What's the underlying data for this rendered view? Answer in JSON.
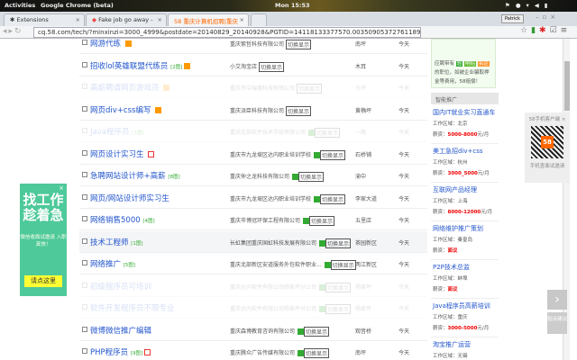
{
  "system_bar": {
    "activities": "Activities",
    "app": "Google Chrome (beta)",
    "clock": "Mon 15:53"
  },
  "tabs": [
    {
      "label": "Extensions"
    },
    {
      "label": "Fake job go away - "
    },
    {
      "label": "58 重庆计算机招聘|重庆"
    }
  ],
  "profile": "Patrick",
  "address_bar": {
    "url": "cq.58.com/tech/?minxinzi=3000_4999&postdate=20140829_20140928&PGTID=14118133377570.0035090537276118994&ClickID=1"
  },
  "switch_label": "切换显示",
  "jobs": [
    {
      "title": "网游代练",
      "pics": "",
      "company": "重庆紫哲科技有限公司",
      "area": "南坪",
      "date": "今天",
      "badge": "orange",
      "verified": false,
      "faded": false
    },
    {
      "title": "招收lol英雄联盟代练员",
      "pics": "[2图]",
      "company": "小艾淘宝店",
      "area": "木耳",
      "date": "今天",
      "badge": "orange",
      "verified": false,
      "faded": false
    },
    {
      "title": "高薪聘请网页游戏员",
      "pics": "",
      "company": "重庆市中瑞德科技有限公司",
      "area": "大坪",
      "date": "今天",
      "badge": "orange",
      "verified": false,
      "faded": true
    },
    {
      "title": "网页div+css编写",
      "pics": "",
      "company": "重庆派臣科技有限公司",
      "area": "黄桷坪",
      "date": "今天",
      "badge": "orange",
      "verified": false,
      "faded": false
    },
    {
      "title": "Java程序员",
      "pics": "[1图]",
      "company": "重庆北部软件技术学校有限公司",
      "area": "一路",
      "date": "今天",
      "badge": "",
      "verified": true,
      "faded": true
    },
    {
      "title": "网页设计实习生",
      "pics": "",
      "company": "重庆市九龙坡区达内职业培训学校",
      "area": "石桥铺",
      "date": "今天",
      "badge": "red",
      "verified": true,
      "faded": false
    },
    {
      "title": "急聘网站设计师+高薪",
      "pics": "[8图]",
      "company": "重庆仲之龙科技有限公司",
      "area": "渝中",
      "date": "今天",
      "badge": "",
      "verified": true,
      "faded": false
    },
    {
      "title": "网页/网站设计师实习生",
      "pics": "",
      "company": "重庆市九龙坡区达内职业培训学校",
      "area": "李家大道",
      "date": "今天",
      "badge": "",
      "verified": true,
      "faded": false
    },
    {
      "title": "网络销售5000",
      "pics": "[4图]",
      "company": "重庆市博冠环保工程有限公司",
      "area": "五里店",
      "date": "今天",
      "badge": "",
      "verified": true,
      "faded": false
    },
    {
      "title": "技术工程师",
      "pics": "[1图]",
      "company": "长虹集团重庆国虹科技发展有限公司",
      "area": "茶园新区",
      "date": "今天",
      "badge": "",
      "verified": true,
      "faded": false,
      "highlight": true
    },
    {
      "title": "网络推广",
      "pics": "[5图]",
      "company": "重庆北部新区安道服务外包软件职业...",
      "area": "两江新区",
      "date": "今天",
      "badge": "",
      "verified": true,
      "faded": false
    },
    {
      "title": "初级程序员可培训",
      "pics": "",
      "company": "重庆达内软件有限公司杨家坪分公司",
      "area": "杨家坪",
      "date": "今天",
      "badge": "",
      "verified": true,
      "faded": true
    },
    {
      "title": "软件开发程序员不限专业",
      "pics": "",
      "company": "重庆达内软件有限公司杨家坪分公司",
      "area": "杨家坪",
      "date": "今天",
      "badge": "",
      "verified": true,
      "faded": true
    },
    {
      "title": "微博微信推广编辑",
      "pics": "",
      "company": "重庆森博教育咨询有限公司",
      "area": "观音桥",
      "date": "今天",
      "badge": "",
      "verified": true,
      "faded": false
    },
    {
      "title": "PHP程序员",
      "pics": "[9图]",
      "company": "重庆腾众广告传媒有限公司",
      "area": "南坪",
      "date": "今天",
      "badge": "red",
      "verified": true,
      "faded": false
    }
  ],
  "sidebar": {
    "warning": {
      "prefix": "应聘带有",
      "tags": [
        "验",
        "明招",
        "名企"
      ],
      "text": "的职位，如被企业骗取押金等费用，58赔偿！"
    },
    "promo_header": "智能推广",
    "area_label": "工作区域：",
    "salary_label": "薪资：",
    "promos": [
      {
        "title": "国内IT就业实习直通车",
        "area": "北京",
        "salary": "5000-8000",
        "unit": "元/月"
      },
      {
        "title": "美工急招div+css",
        "area": "杭州",
        "salary": "3000_5000",
        "unit": "元/月"
      },
      {
        "title": "互联网产品经理",
        "area": "上海",
        "salary": "8000-12000",
        "unit": "元/月"
      },
      {
        "title": "网络维护推广策划",
        "area": "秦皇岛",
        "salary": "面议",
        "unit": ""
      },
      {
        "title": "P2P技术总监",
        "area": "蚌埠",
        "salary": "面议",
        "unit": ""
      },
      {
        "title": "Java程序员高薪培训",
        "area": "重庆",
        "salary": "3000-5000",
        "unit": "元/月"
      },
      {
        "title": "淘宝推广运营",
        "area": "无锡",
        "salary": "",
        "unit": ""
      }
    ]
  },
  "qr_widget": {
    "title": "58手机客户端",
    "caption": "手机查面试邀请",
    "logo": "58"
  },
  "feedback": "投诉建议",
  "ad": {
    "headline": "找工作 趁着急",
    "sub": "微信收面试邀请 入职真快！",
    "button": "请点这里"
  }
}
